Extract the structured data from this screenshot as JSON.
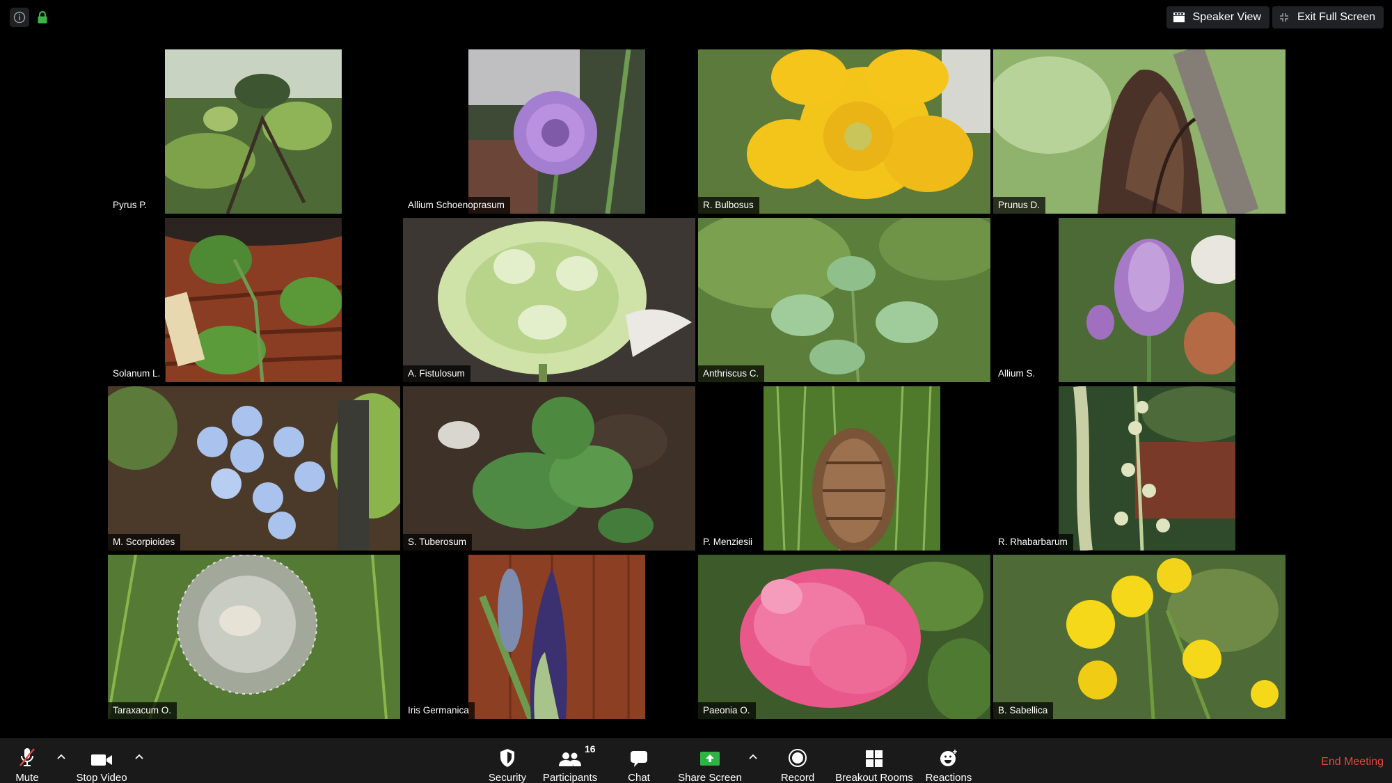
{
  "top_bar": {
    "icons": [
      "info-icon",
      "lock-icon"
    ],
    "speaker_view": "Speaker View",
    "exit_full_screen": "Exit Full Screen",
    "lock_color": "#3cb548"
  },
  "tiles": [
    {
      "name": "Pyrus P.",
      "subject": "pear-leaves"
    },
    {
      "name": "Allium Schoenoprasum",
      "subject": "chive-flower"
    },
    {
      "name": "R. Bulbosus",
      "subject": "yellow-buttercup"
    },
    {
      "name": "Prunus D.",
      "subject": "dried-leaf"
    },
    {
      "name": "Solanum L.",
      "subject": "tomato-seedling"
    },
    {
      "name": "A. Fistulosum",
      "subject": "white-onion-flower"
    },
    {
      "name": "Anthriscus C.",
      "subject": "chervil-leaves"
    },
    {
      "name": "Allium S.",
      "subject": "chive-bud"
    },
    {
      "name": "M. Scorpioides",
      "subject": "forget-me-not"
    },
    {
      "name": "S. Tuberosum",
      "subject": "potato-sprout"
    },
    {
      "name": "P. Menziesii",
      "subject": "pine-cone"
    },
    {
      "name": "R. Rhabarbarum",
      "subject": "rhubarb-flower"
    },
    {
      "name": "Taraxacum O.",
      "subject": "dandelion-seedhead"
    },
    {
      "name": "Iris Germanica",
      "subject": "iris-bud"
    },
    {
      "name": "Paeonia O.",
      "subject": "pink-peony"
    },
    {
      "name": "B. Sabellica",
      "subject": "kale-flowers"
    }
  ],
  "active_speaker": "A. Fistulosum",
  "active_outline_color": "#eef0a5",
  "toolbar": {
    "mute": "Mute",
    "stop_video": "Stop Video",
    "security": "Security",
    "participants": "Participants",
    "participant_count": "16",
    "chat": "Chat",
    "share_screen": "Share Screen",
    "record": "Record",
    "breakout_rooms": "Breakout Rooms",
    "reactions": "Reactions",
    "end_meeting": "End Meeting",
    "share_color": "#2fb344",
    "end_color": "#e1483e"
  }
}
